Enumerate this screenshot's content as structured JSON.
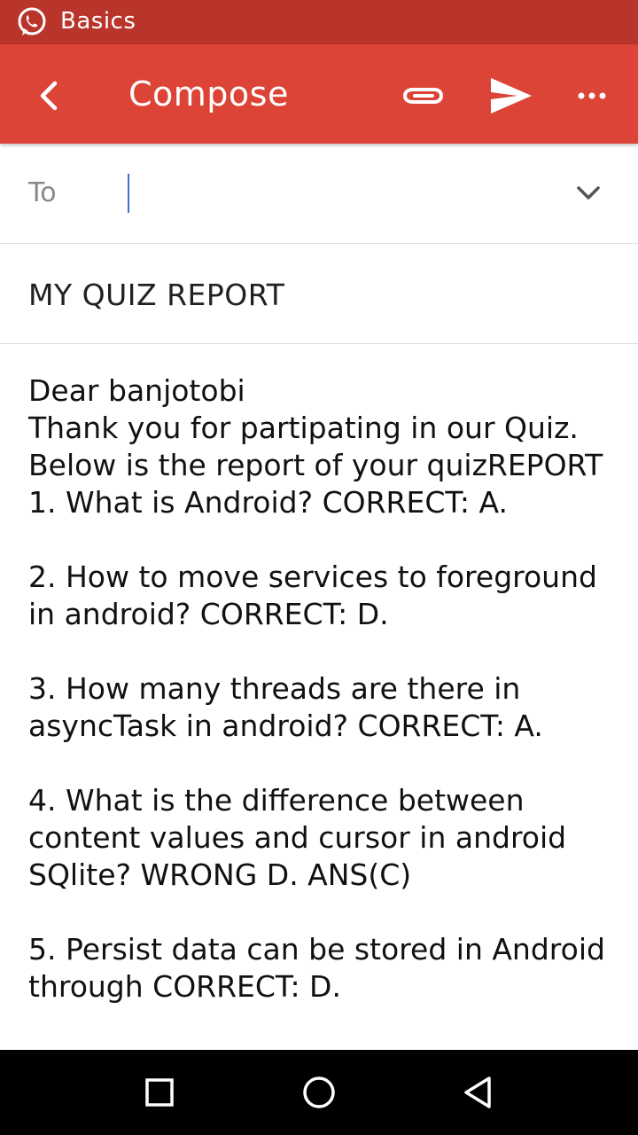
{
  "status_bar": {
    "app_name": "Basics",
    "icon": "whatsapp-icon"
  },
  "toolbar": {
    "title": "Compose",
    "icons": [
      "back-arrow-icon",
      "paperclip-icon",
      "send-icon",
      "more-options-icon"
    ]
  },
  "to_field": {
    "label": "To",
    "value": "",
    "dropdown_icon": "chevron-down-icon"
  },
  "subject": {
    "value": "MY QUIZ REPORT"
  },
  "body": {
    "text": "Dear banjotobi\nThank you for partipating in our Quiz.\nBelow is the report of your quizREPORT\n1. What is Android? CORRECT: A.\n\n2. How to move services to foreground in android? CORRECT: D.\n\n3. How many threads are there in asyncTask in android? CORRECT: A.\n\n4. What is the difference between content values and cursor in android SQlite? WRONG D. ANS(C)\n\n5. Persist data can be stored in Android through CORRECT: D."
  },
  "nav_bar": {
    "icons": [
      "recents-square-icon",
      "home-circle-icon",
      "back-triangle-icon"
    ]
  },
  "colors": {
    "status_bar": "#b9342a",
    "toolbar": "#db4437",
    "caret": "#3b6fd1"
  }
}
